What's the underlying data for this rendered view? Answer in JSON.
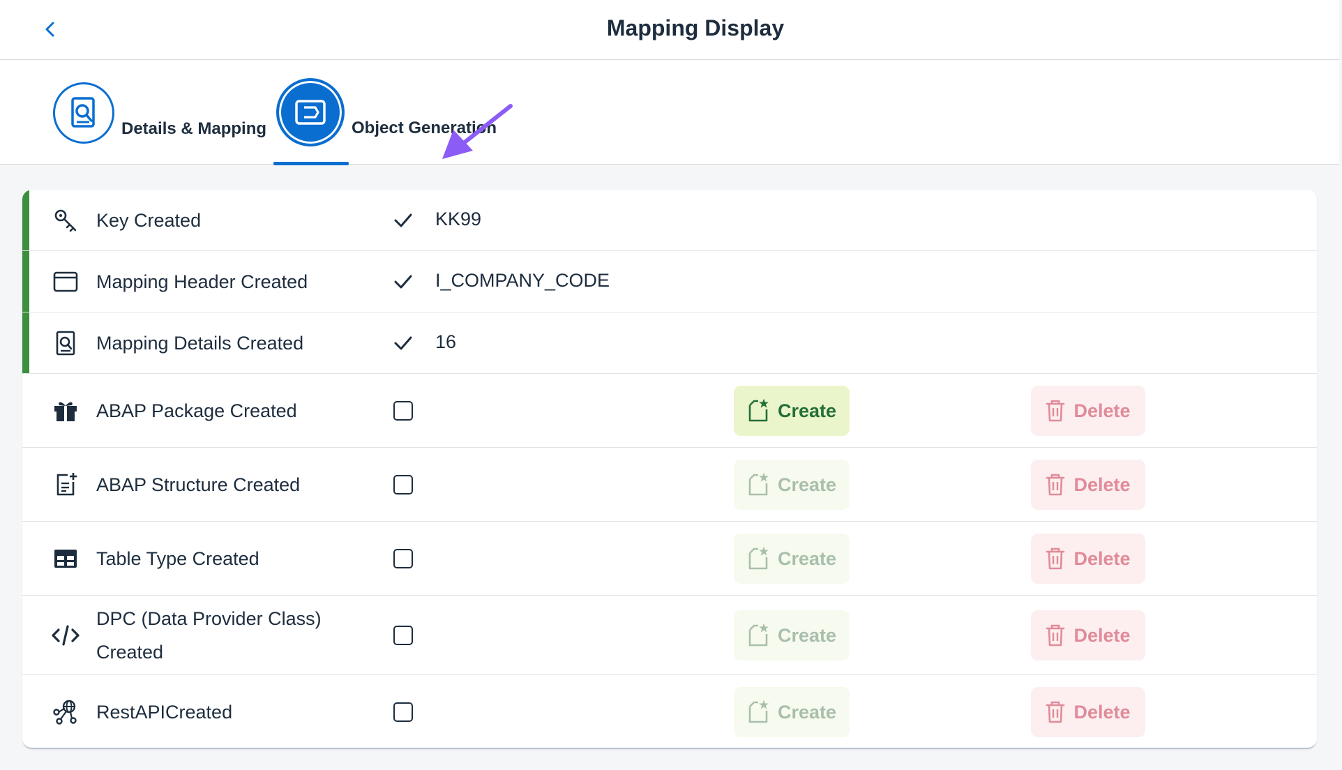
{
  "header": {
    "title": "Mapping Display"
  },
  "tabs": [
    {
      "label": "Details & Mapping"
    },
    {
      "label": "Object Generation"
    }
  ],
  "rows": [
    {
      "label": "Key Created",
      "value": "KK99"
    },
    {
      "label": "Mapping Header Created",
      "value": "I_COMPANY_CODE"
    },
    {
      "label": "Mapping Details Created",
      "value": "16"
    },
    {
      "label": "ABAP Package Created"
    },
    {
      "label": "ABAP Structure Created"
    },
    {
      "label": "Table Type Created"
    },
    {
      "label": "DPC (Data Provider Class) Created"
    },
    {
      "label": "RestAPICreated"
    }
  ],
  "actions": {
    "create_label": "Create",
    "delete_label": "Delete"
  },
  "colors": {
    "accent": "#0a6ed1",
    "success": "#3d8f3f",
    "arrow": "#8b5cf6"
  }
}
